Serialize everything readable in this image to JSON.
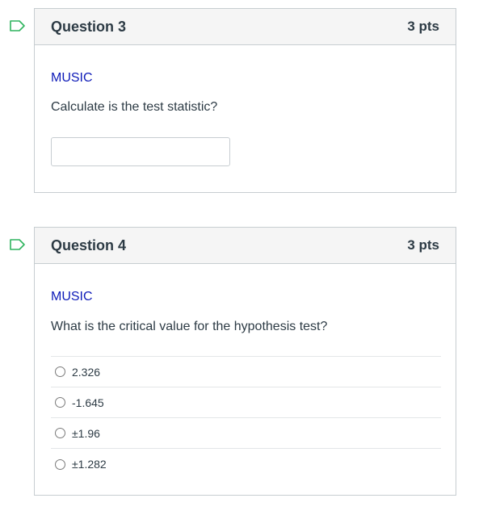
{
  "questions": [
    {
      "title": "Question 3",
      "points": "3 pts",
      "topic": "MUSIC",
      "text": "Calculate is the test statistic?",
      "answer_value": ""
    },
    {
      "title": "Question 4",
      "points": "3 pts",
      "topic": "MUSIC",
      "text": "What is the critical value for the hypothesis test?",
      "options": [
        "2.326",
        "-1.645",
        "±1.96",
        "±1.282"
      ]
    }
  ],
  "colors": {
    "accent_topic": "#0e1bb8",
    "text": "#2d3b45",
    "border": "#c7cdd1",
    "header_bg": "#f5f5f5"
  },
  "icons": {
    "flag": "flag-question-icon"
  }
}
